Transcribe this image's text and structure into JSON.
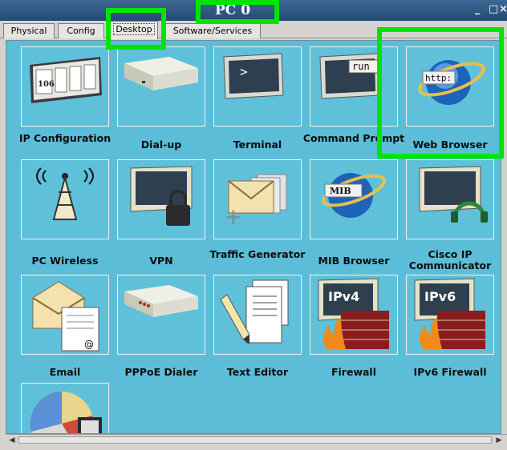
{
  "window": {
    "title": "PC 0",
    "minimize_glyph": "_",
    "maximize_glyph": "□",
    "close_glyph": "×"
  },
  "tabs": [
    {
      "label": "Physical",
      "active": false
    },
    {
      "label": "Config",
      "active": false
    },
    {
      "label": "Desktop",
      "active": true
    },
    {
      "label": "Software/Services",
      "active": false
    }
  ],
  "apps": [
    {
      "label": "IP Configuration",
      "icon": "ip-configuration-icon",
      "art_text": "106"
    },
    {
      "label": "Dial-up",
      "icon": "modem-icon"
    },
    {
      "label": "Terminal",
      "icon": "terminal-icon",
      "art_text": ">"
    },
    {
      "label": "Command Prompt",
      "icon": "command-prompt-icon",
      "art_text": "run"
    },
    {
      "label": "Web Browser",
      "icon": "web-browser-icon",
      "art_text": "http:"
    },
    {
      "label": "PC Wireless",
      "icon": "wireless-tower-icon"
    },
    {
      "label": "VPN",
      "icon": "vpn-lock-icon"
    },
    {
      "label": "Traffic Generator",
      "icon": "traffic-generator-icon"
    },
    {
      "label": "MIB Browser",
      "icon": "mib-browser-icon",
      "art_text": "MIB"
    },
    {
      "label": "Cisco IP Communicator",
      "icon": "ip-communicator-icon"
    },
    {
      "label": "Email",
      "icon": "email-icon",
      "art_text": "@"
    },
    {
      "label": "PPPoE Dialer",
      "icon": "pppoe-dialer-icon"
    },
    {
      "label": "Text Editor",
      "icon": "text-editor-icon"
    },
    {
      "label": "Firewall",
      "icon": "firewall-icon",
      "art_text": "IPv4"
    },
    {
      "label": "IPv6 Firewall",
      "icon": "ipv6-firewall-icon",
      "art_text": "IPv6"
    },
    {
      "label": "",
      "icon": "pie-chart-app-icon"
    }
  ],
  "colors": {
    "desktop_background": "#5bbdd8",
    "highlight": "#00e400"
  }
}
